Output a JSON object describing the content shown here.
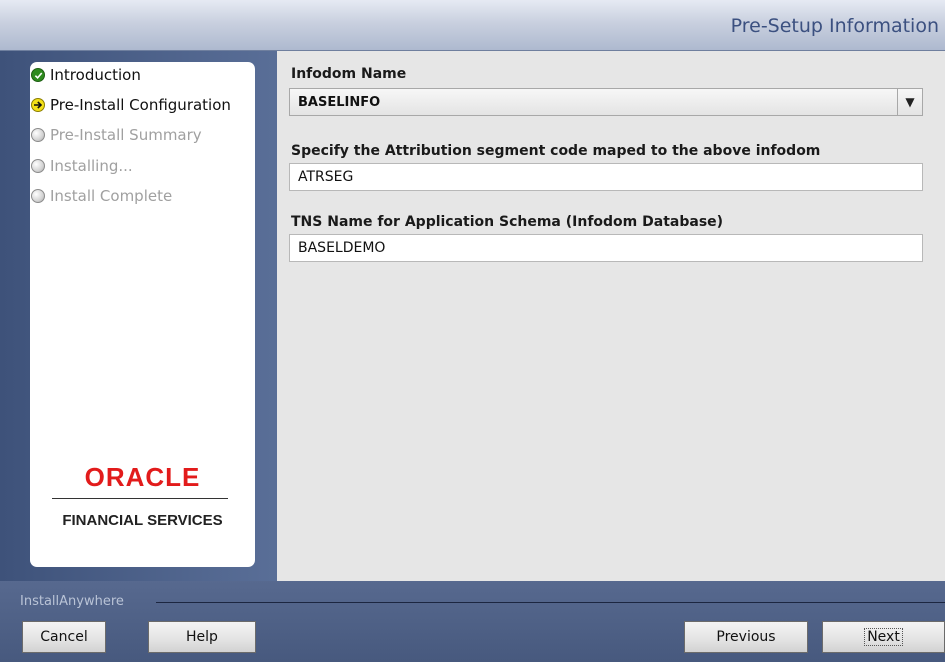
{
  "header": {
    "title": "Pre-Setup Information"
  },
  "steps": [
    {
      "label": "Introduction",
      "state": "done"
    },
    {
      "label": "Pre-Install Configuration",
      "state": "current"
    },
    {
      "label": "Pre-Install Summary",
      "state": "pending"
    },
    {
      "label": "Installing...",
      "state": "pending"
    },
    {
      "label": "Install Complete",
      "state": "pending"
    }
  ],
  "logo": {
    "brand": "ORACLE",
    "sub": "FINANCIAL SERVICES"
  },
  "form": {
    "infodom_label": "Infodom Name",
    "infodom_value": "BASELINFO",
    "segment_label": "Specify the Attribution segment code maped to the above infodom",
    "segment_value": "ATRSEG",
    "tns_label": "TNS Name for Application Schema (Infodom Database)",
    "tns_value": "BASELDEMO"
  },
  "footer": {
    "brand": "InstallAnywhere",
    "cancel": "Cancel",
    "help": "Help",
    "previous": "Previous",
    "next": "Next"
  }
}
